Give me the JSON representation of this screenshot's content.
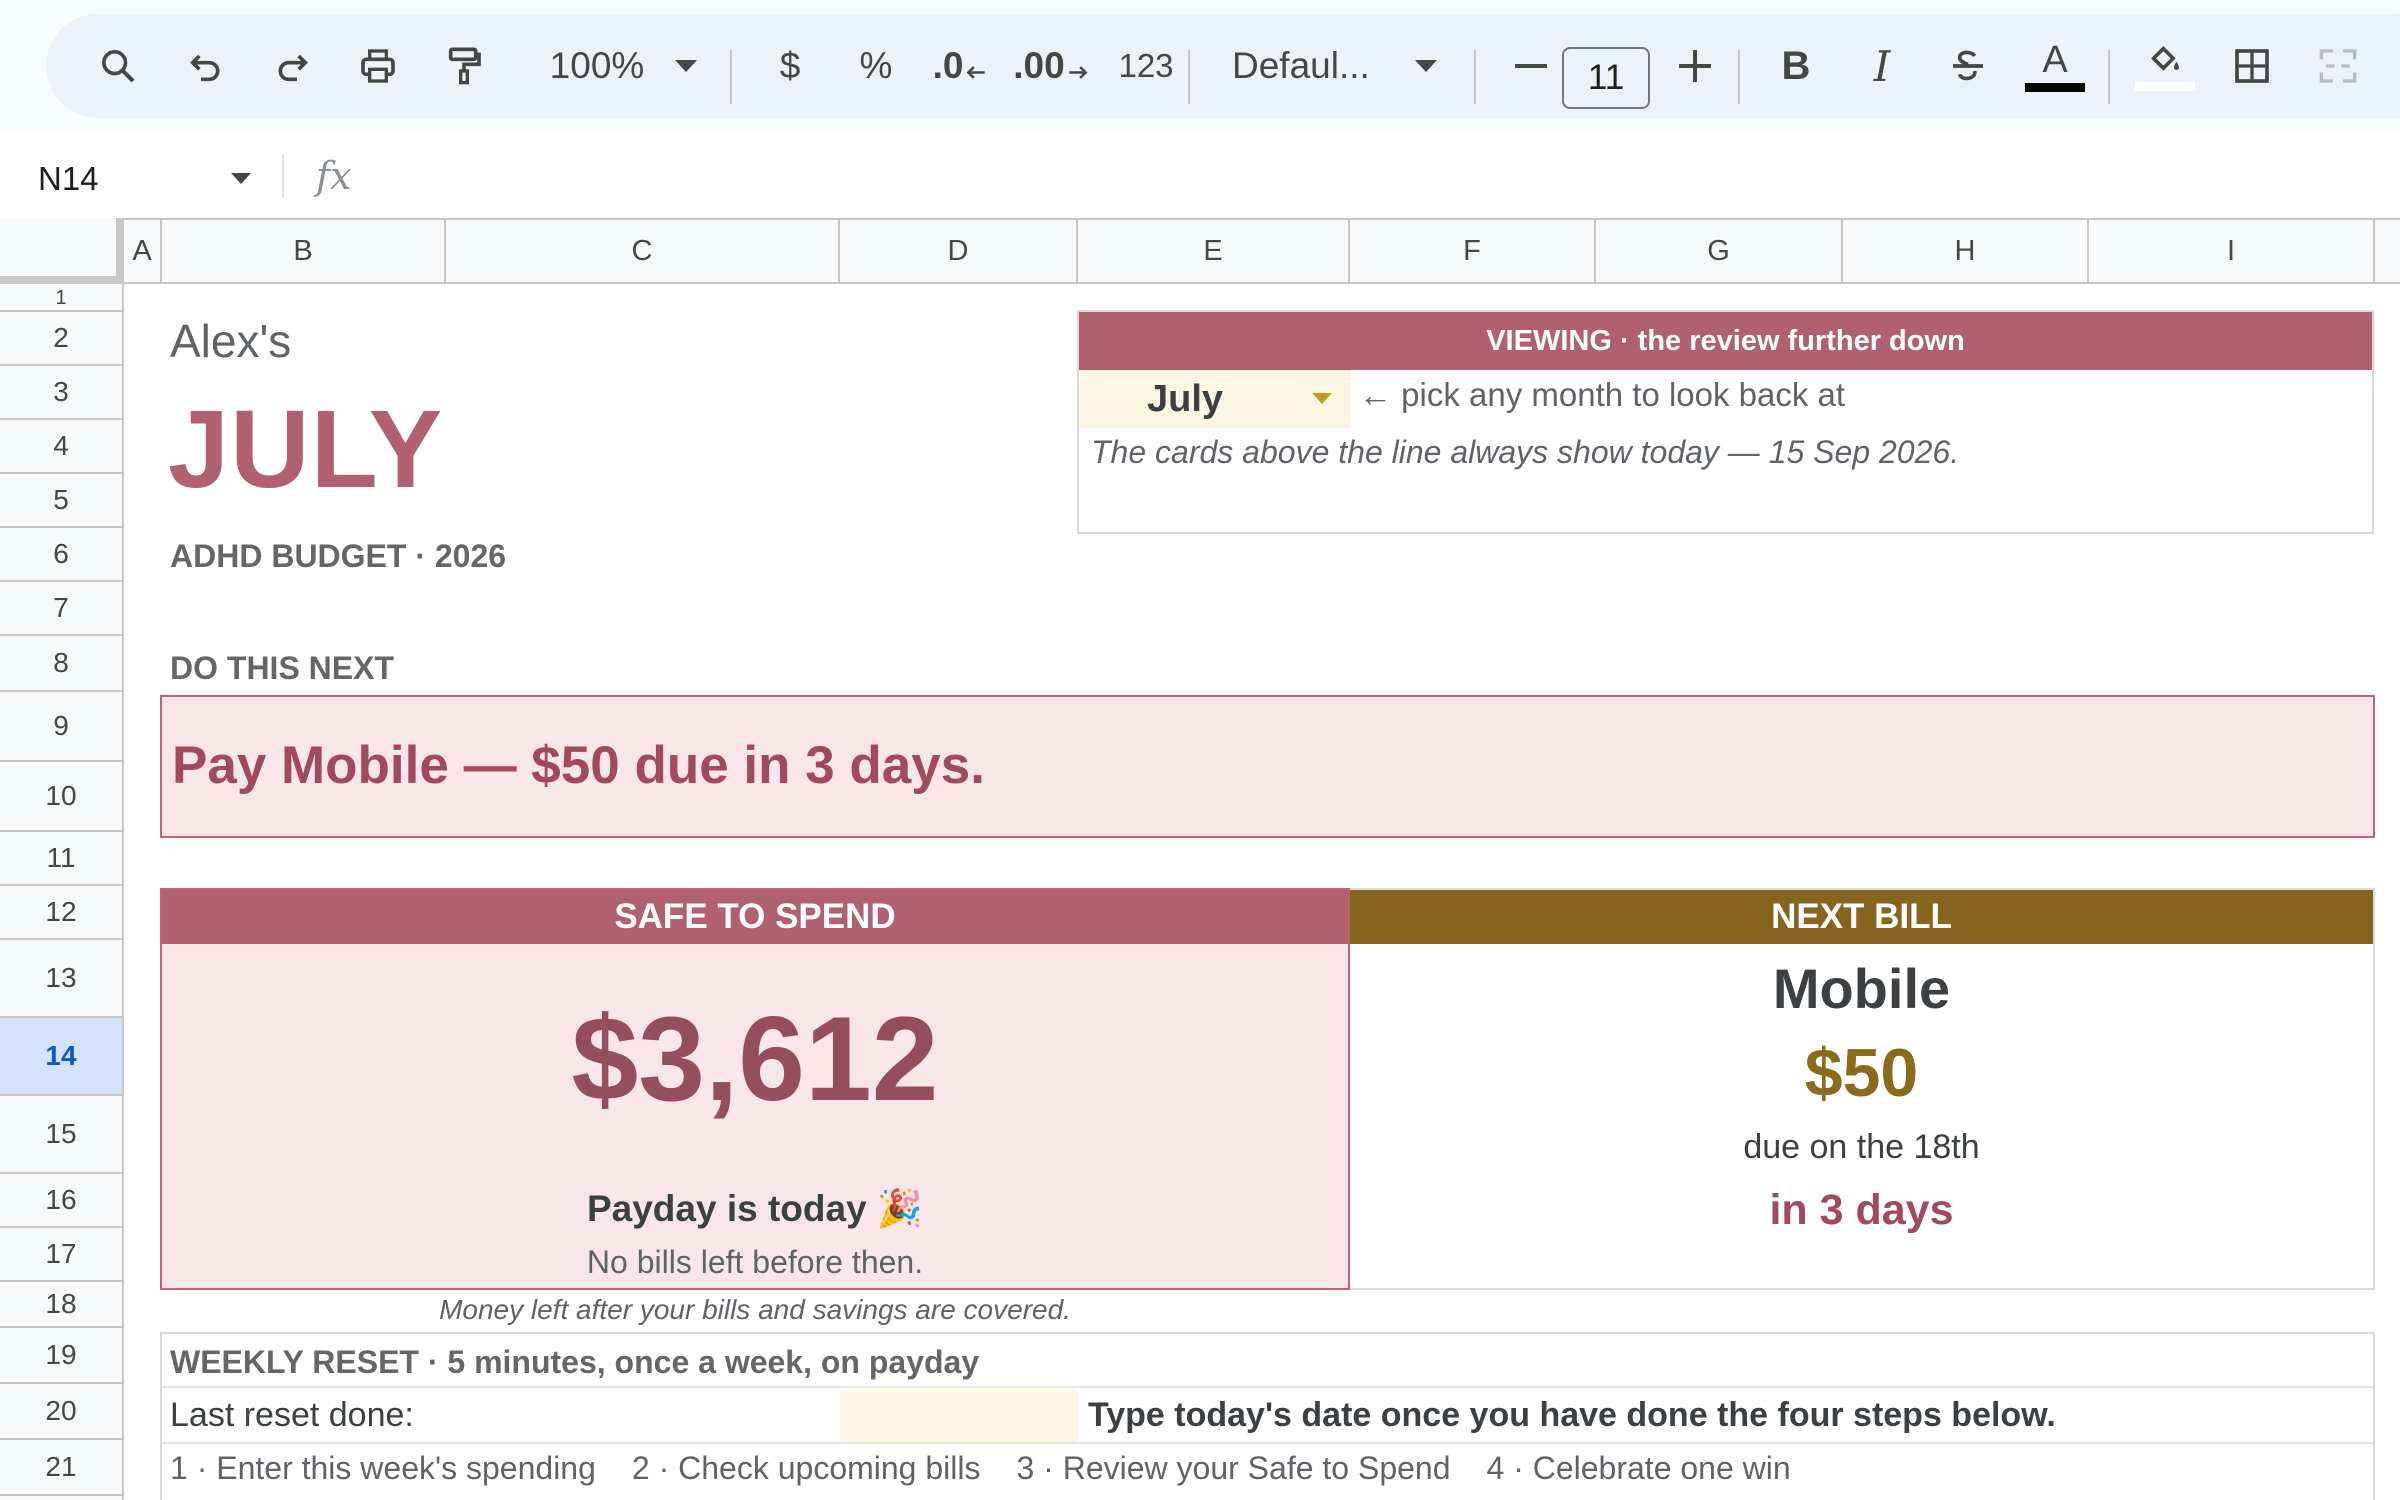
{
  "toolbar": {
    "zoom": "100%",
    "currency_label": "$",
    "percent_label": "%",
    "decrease_decimal_label": ".0",
    "increase_decimal_label": ".00",
    "number_format_label": "123",
    "font_name": "Defaul...",
    "font_size": "11",
    "text_color": "#000000",
    "fill_color": "#ffffff"
  },
  "formula_bar": {
    "cell_ref": "N14",
    "fx_label": "fx"
  },
  "columns": [
    "A",
    "B",
    "C",
    "D",
    "E",
    "F",
    "G",
    "H",
    "I"
  ],
  "rows": [
    "1",
    "2",
    "3",
    "4",
    "5",
    "6",
    "7",
    "8",
    "9",
    "10",
    "11",
    "12",
    "13",
    "14",
    "15",
    "16",
    "17",
    "18",
    "19",
    "20",
    "21"
  ],
  "selected_row": "14",
  "sheet": {
    "owner": "Alex's",
    "month_title": "JULY",
    "subtitle": "ADHD BUDGET  ·  2026",
    "viewing": {
      "header": "VIEWING  ·  the review further down",
      "selected_month": "July",
      "hint": "←  pick any month to look back at",
      "note": "The cards above the line always show today — 15 Sep 2026."
    },
    "next_action": {
      "label": "DO THIS NEXT",
      "text": "Pay Mobile — $50 due in 3 days."
    },
    "safe_to_spend": {
      "header": "SAFE TO SPEND",
      "amount": "$3,612",
      "payday": "Payday is today 🎉",
      "note": "No bills left before then.",
      "caption": "Money left after your bills and savings are covered."
    },
    "next_bill": {
      "header": "NEXT BILL",
      "name": "Mobile",
      "amount": "$50",
      "due": "due on the 18th",
      "days": "in 3 days"
    },
    "weekly_reset": {
      "title": "WEEKLY RESET  ·  5 minutes, once a week, on payday",
      "last_label": "Last reset done:",
      "instruction": "Type today's date once you have done the four steps below.",
      "steps": [
        "1 · Enter this week's spending",
        "2 · Check upcoming bills",
        "3 · Review your Safe to Spend",
        "4 · Celebrate one win"
      ]
    }
  },
  "colors": {
    "rose": "#b0606e",
    "rose_text": "#a24a5d",
    "pink_fill": "#f9e6ea",
    "gold": "#856520",
    "cream": "#fdf6e3",
    "selection": "#d3e3fd"
  }
}
